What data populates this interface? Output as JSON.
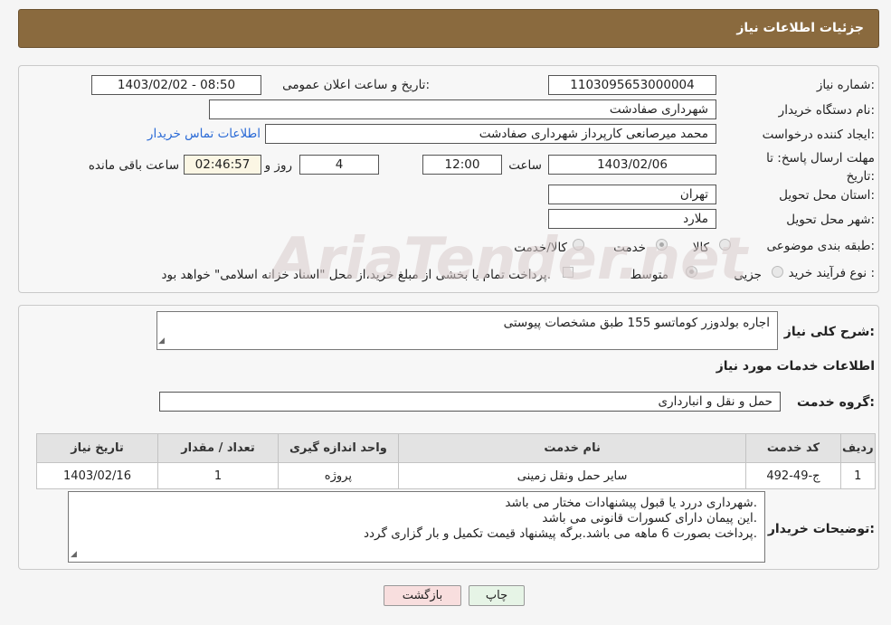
{
  "header": {
    "title": "جزئیات اطلاعات نیاز"
  },
  "form": {
    "need_number_label": "شماره نیاز:",
    "need_number": "1103095653000004",
    "announce_label": "تاریخ و ساعت اعلان عمومی:",
    "announce_value": "1403/02/02 - 08:50",
    "buyer_label": "نام دستگاه خریدار:",
    "buyer_value": "شهرداری صفادشت",
    "creator_label": "ایجاد کننده درخواست:",
    "creator_value": "محمد میرصانعی کارپرداز شهرداری صفادشت",
    "contact_link": "اطلاعات تماس خریدار",
    "deadline_label": "مهلت ارسال پاسخ: تا تاریخ:",
    "deadline_date": "1403/02/06",
    "time_label": "ساعت",
    "deadline_time": "12:00",
    "days_value": "4",
    "days_label": "روز و",
    "remaining_value": "02:46:57",
    "remaining_label": "ساعت باقی مانده",
    "province_label": "استان محل تحویل:",
    "province_value": "تهران",
    "city_label": "شهر محل تحویل:",
    "city_value": "ملارد",
    "category_label": "طبقه بندی موضوعی:",
    "category_options": [
      "کالا",
      "خدمت",
      "کالا/خدمت"
    ],
    "category_selected": "خدمت",
    "process_label": "نوع فرآیند خرید :",
    "process_options": [
      "جزیی",
      "متوسط"
    ],
    "process_selected": "متوسط",
    "payment_note": "پرداخت تمام یا بخشی از مبلغ خرید،از محل \"اسناد خزانه اسلامی\" خواهد بود."
  },
  "description": {
    "label": "شرح کلی نیاز:",
    "value": "اجاره بولدوزر کوماتسو 155 طبق مشخصات پیوستی"
  },
  "services": {
    "title": "اطلاعات خدمات مورد نیاز",
    "group_label": "گروه خدمت:",
    "group_value": "حمل و نقل و انبارداری",
    "table": {
      "columns": [
        "ردیف",
        "کد خدمت",
        "نام خدمت",
        "واحد اندازه گیری",
        "تعداد / مقدار",
        "تاریخ نیاز"
      ],
      "rows": [
        [
          "1",
          "ج-49-492",
          "سایر حمل ونقل زمینی",
          "پروژه",
          "1",
          "1403/02/16"
        ]
      ]
    }
  },
  "buyer_notes": {
    "label": "توضیحات خریدار:",
    "lines": [
      "شهرداری دررد یا قبول پیشنهادات مختار می باشد.",
      "این پیمان دارای کسورات قانونی می باشد.",
      "پرداخت بصورت 6 ماهه می باشد.برگه پیشنهاد قیمت تکمیل و بار گزاری گردد."
    ]
  },
  "buttons": {
    "print": "چاپ",
    "back": "بازگشت"
  },
  "watermark": "AriaTender.net",
  "colors": {
    "header_bg": "#8a6a3e",
    "link": "#2a6ad6",
    "back_button_bg": "#f8dede",
    "print_button_bg": "#e6f4e6"
  }
}
